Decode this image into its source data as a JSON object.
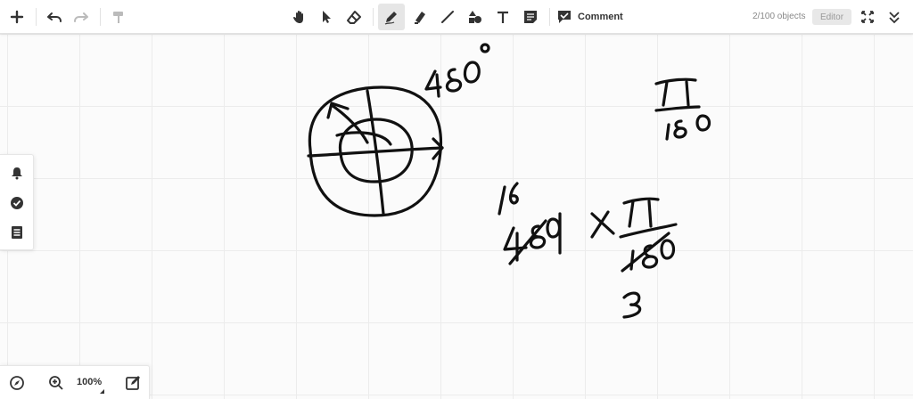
{
  "toolbar": {
    "comment_label": "Comment",
    "objects_count": "2/100 objects",
    "editor_label": "Editor"
  },
  "zoom": {
    "level": "100%"
  },
  "canvas": {
    "annotations": [
      "480°",
      "π/180",
      "6",
      "480",
      "×",
      "π",
      "180",
      "3"
    ]
  },
  "icons": {
    "add": "plus-icon",
    "undo": "undo-icon",
    "redo": "redo-icon",
    "format": "paint-roller-icon",
    "hand": "hand-icon",
    "select": "cursor-icon",
    "eraser": "eraser-icon",
    "pen": "pen-icon",
    "highlighter": "highlighter-icon",
    "line": "line-icon",
    "shapes": "shapes-icon",
    "text": "text-icon",
    "sticky": "note-icon",
    "comment": "comment-icon",
    "fit": "fit-screen-icon",
    "collapse": "chevrons-down-icon",
    "bell": "bell-icon",
    "check": "check-circle-icon",
    "list": "list-icon",
    "compass": "compass-icon",
    "zoom_in": "zoom-in-icon",
    "edit": "edit-icon"
  },
  "colors": {
    "ink": "#111111",
    "accent": "#333333",
    "active_tool_bg": "#e6e6e6"
  }
}
